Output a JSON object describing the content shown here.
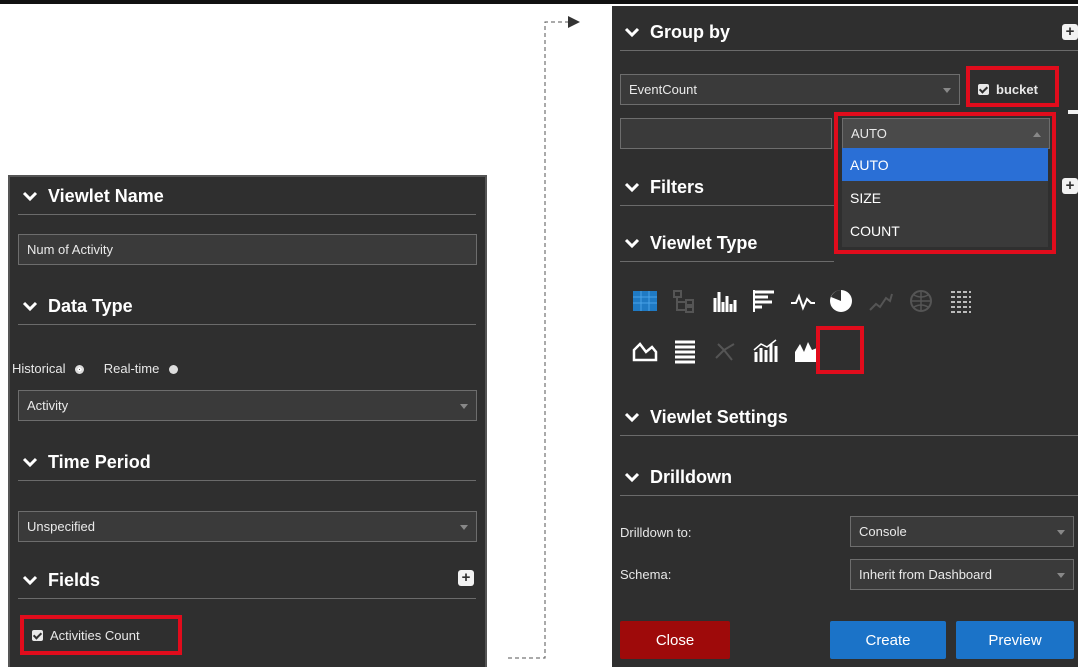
{
  "left": {
    "viewlet_name": {
      "title": "Viewlet Name",
      "value": "Num of Activity"
    },
    "data_type": {
      "title": "Data Type",
      "historical": "Historical",
      "realtime": "Real-time",
      "selected": "Activity"
    },
    "time_period": {
      "title": "Time Period",
      "selected": "Unspecified"
    },
    "fields": {
      "title": "Fields",
      "item": "Activities Count"
    }
  },
  "right": {
    "group_by": {
      "title": "Group by",
      "field": "EventCount",
      "bucket_label": "bucket"
    },
    "bucket_mode": {
      "selected": "AUTO",
      "options": [
        "AUTO",
        "SIZE",
        "COUNT"
      ],
      "highlighted": "AUTO"
    },
    "filters": {
      "title": "Filters"
    },
    "viewlet_type": {
      "title": "Viewlet Type",
      "icons": [
        "table-icon",
        "tree-icon",
        "column-chart-icon",
        "bar-chart-icon",
        "line-chart-icon",
        "pie-chart-icon",
        "scatter-chart-icon",
        "map-icon",
        "matrix-icon",
        "area-chart-icon",
        "list-icon",
        "network-icon",
        "combo-chart-icon",
        "histogram-icon"
      ],
      "selected": "histogram-icon"
    },
    "viewlet_settings": {
      "title": "Viewlet Settings"
    },
    "drilldown": {
      "title": "Drilldown",
      "drilldown_to_label": "Drilldown to:",
      "drilldown_to_value": "Console",
      "schema_label": "Schema:",
      "schema_value": "Inherit from Dashboard"
    },
    "buttons": {
      "close": "Close",
      "create": "Create",
      "preview": "Preview"
    }
  },
  "colors": {
    "panel": "#2f2f2f",
    "highlight": "#e10c1c",
    "close": "#9e0a0a",
    "primary": "#1b73c8",
    "option_selected": "#2a6fd6"
  }
}
